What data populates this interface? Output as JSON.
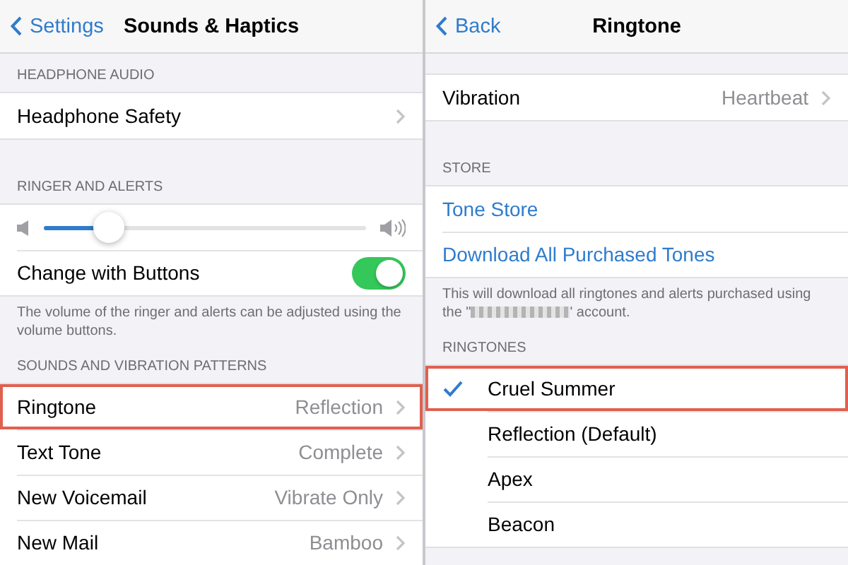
{
  "panels": [
    {
      "nav": {
        "back": "Settings",
        "title": "Sounds & Haptics"
      },
      "sections": [
        {
          "header": "HEADPHONE AUDIO",
          "rows": [
            {
              "kind": "link",
              "label": "Headphone Safety"
            }
          ]
        },
        {
          "header": "RINGER AND ALERTS",
          "rows": [
            {
              "kind": "slider",
              "level": 0.2
            },
            {
              "kind": "toggle",
              "label": "Change with Buttons",
              "on": true
            }
          ],
          "footer": "The volume of the ringer and alerts can be adjusted using the volume buttons."
        },
        {
          "header": "SOUNDS AND VIBRATION PATTERNS",
          "rows": [
            {
              "kind": "link",
              "label": "Ringtone",
              "value": "Reflection",
              "highlighted": true
            },
            {
              "kind": "link",
              "label": "Text Tone",
              "value": "Complete",
              "highlighted": false
            },
            {
              "kind": "link",
              "label": "New Voicemail",
              "value": "Vibrate Only",
              "highlighted": false
            },
            {
              "kind": "link",
              "label": "New Mail",
              "value": "Bamboo",
              "highlighted": false
            }
          ]
        }
      ]
    },
    {
      "nav": {
        "back": "Back",
        "title": "Ringtone"
      },
      "sections": [
        {
          "rows": [
            {
              "kind": "link",
              "label": "Vibration",
              "value": "Heartbeat"
            }
          ]
        },
        {
          "header": "STORE",
          "rows": [
            {
              "kind": "action",
              "label": "Tone Store"
            },
            {
              "kind": "action",
              "label": "Download All Purchased Tones"
            }
          ],
          "footer": "This will download all ringtones and alerts purchased using the \"",
          "footer_after_redaction": "' account."
        },
        {
          "header": "RINGTONES",
          "rows": [
            {
              "kind": "choice",
              "label": "Cruel Summer",
              "selected": true,
              "highlighted": true
            },
            {
              "kind": "choice",
              "label": "Reflection (Default)",
              "selected": false,
              "highlighted": false
            },
            {
              "kind": "choice",
              "label": "Apex",
              "selected": false,
              "highlighted": false
            },
            {
              "kind": "choice",
              "label": "Beacon",
              "selected": false,
              "highlighted": false
            }
          ]
        }
      ]
    }
  ]
}
